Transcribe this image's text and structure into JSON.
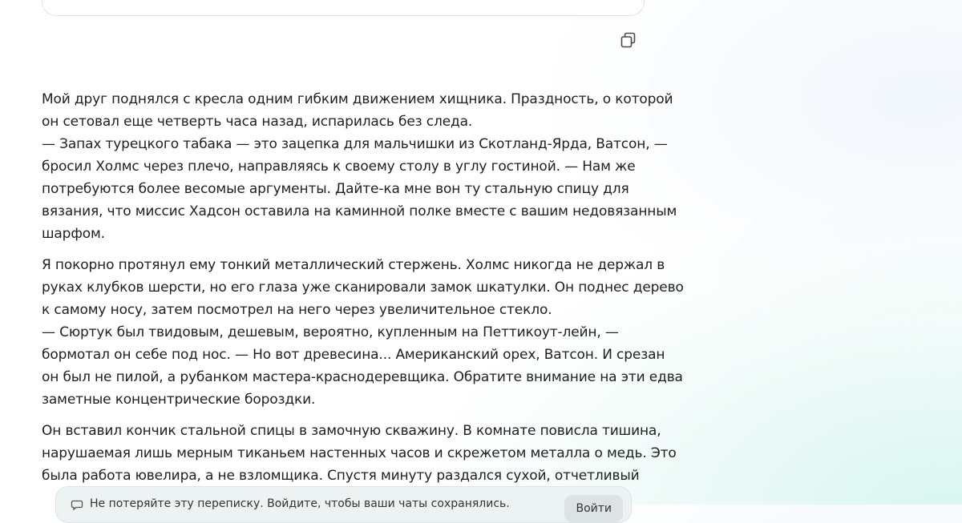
{
  "story": {
    "paragraphs": [
      {
        "lines": [
          "Мой друг поднялся с кресла одним гибким движением хищника. Праздность, о которой",
          "он сетовал еще четверть часа назад, испарилась без следа.",
          "— Запах турецкого табака — это зацепка для мальчишки из Скотланд-Ярда, Ватсон, —",
          "бросил Холмс через плечо, направляясь к своему столу в углу гостиной. — Нам же",
          "потребуются более весомые аргументы. Дайте-ка мне вон ту стальную спицу для",
          "вязания, что миссис Хадсон оставила на каминной полке вместе с вашим недовязанным",
          "шарфом."
        ]
      },
      {
        "lines": [
          "Я покорно протянул ему тонкий металлический стержень. Холмс никогда не держал в",
          "руках клубков шерсти, но его глаза уже сканировали замок шкатулки. Он поднес дерево",
          "к самому носу, затем посмотрел на него через увеличительное стекло.",
          "— Сюртук был твидовым, дешевым, вероятно, купленным на Петтикоут-лейн, —",
          "бормотал он себе под нос. — Но вот древесина... Американский орех, Ватсон. И срезан",
          "он был не пилой, а рубанком мастера-краснодеревщика. Обратите внимание на эти едва",
          "заметные концентрические бороздки."
        ]
      },
      {
        "lines": [
          "Он вставил кончик стальной спицы в замочную скважину. В комнате повисла тишина,",
          "нарушаемая лишь мерным тиканьем настенных часов и скрежетом металла о медь. Это",
          "была работа ювелира, а не взломщика. Спустя минуту раздался сухой, отчетливый"
        ]
      }
    ]
  },
  "icons": {
    "copy": "copy-icon",
    "chat_bubble": "chat-bubble-icon"
  },
  "login_bar": {
    "text": "Не потеряйте эту переписку. Войдите, чтобы ваши чаты сохранялись.",
    "button_label": "Войти"
  },
  "colors": {
    "text": "#1f1f1f",
    "background_tint": "#d2f4ec"
  }
}
